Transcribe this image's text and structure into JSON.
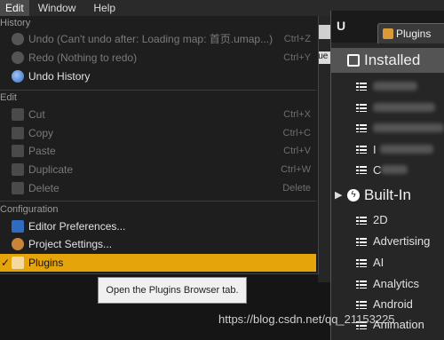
{
  "menubar": {
    "items": [
      "Edit",
      "Window",
      "Help"
    ]
  },
  "edit_menu": {
    "history": {
      "title": "History",
      "undo": {
        "label": "Undo (Can't undo after: Loading map: 首页.umap...)",
        "shortcut": "Ctrl+Z"
      },
      "redo": {
        "label": "Redo (Nothing to redo)",
        "shortcut": "Ctrl+Y"
      },
      "undo_history": {
        "label": "Undo History"
      }
    },
    "edit": {
      "title": "Edit",
      "cut": {
        "label": "Cut",
        "shortcut": "Ctrl+X"
      },
      "copy": {
        "label": "Copy",
        "shortcut": "Ctrl+C"
      },
      "paste": {
        "label": "Paste",
        "shortcut": "Ctrl+V"
      },
      "duplicate": {
        "label": "Duplicate",
        "shortcut": "Ctrl+W"
      },
      "delete": {
        "label": "Delete",
        "shortcut": "Delete"
      }
    },
    "configuration": {
      "title": "Configuration",
      "editor_preferences": {
        "label": "Editor Preferences..."
      },
      "project_settings": {
        "label": "Project Settings..."
      },
      "plugins": {
        "label": "Plugins",
        "checkmark": "✓"
      }
    }
  },
  "tooltip": {
    "text": "Open the Plugins Browser tab."
  },
  "background": {
    "partial_label": "lue"
  },
  "plugins_panel": {
    "logo": "U",
    "tab_label": "Plugins",
    "installed": {
      "label": "Installed"
    },
    "installed_items": [
      "",
      "",
      "",
      "I",
      "C"
    ],
    "built_in": {
      "label": "Built-In"
    },
    "built_in_items": [
      "2D",
      "Advertising",
      "AI",
      "Analytics",
      "Android",
      "Animation"
    ]
  },
  "watermark": "https://blog.csdn.net/qq_21153225",
  "colors": {
    "highlight": "#e5a50a",
    "tooltip_bg": "#f0f0f0"
  }
}
